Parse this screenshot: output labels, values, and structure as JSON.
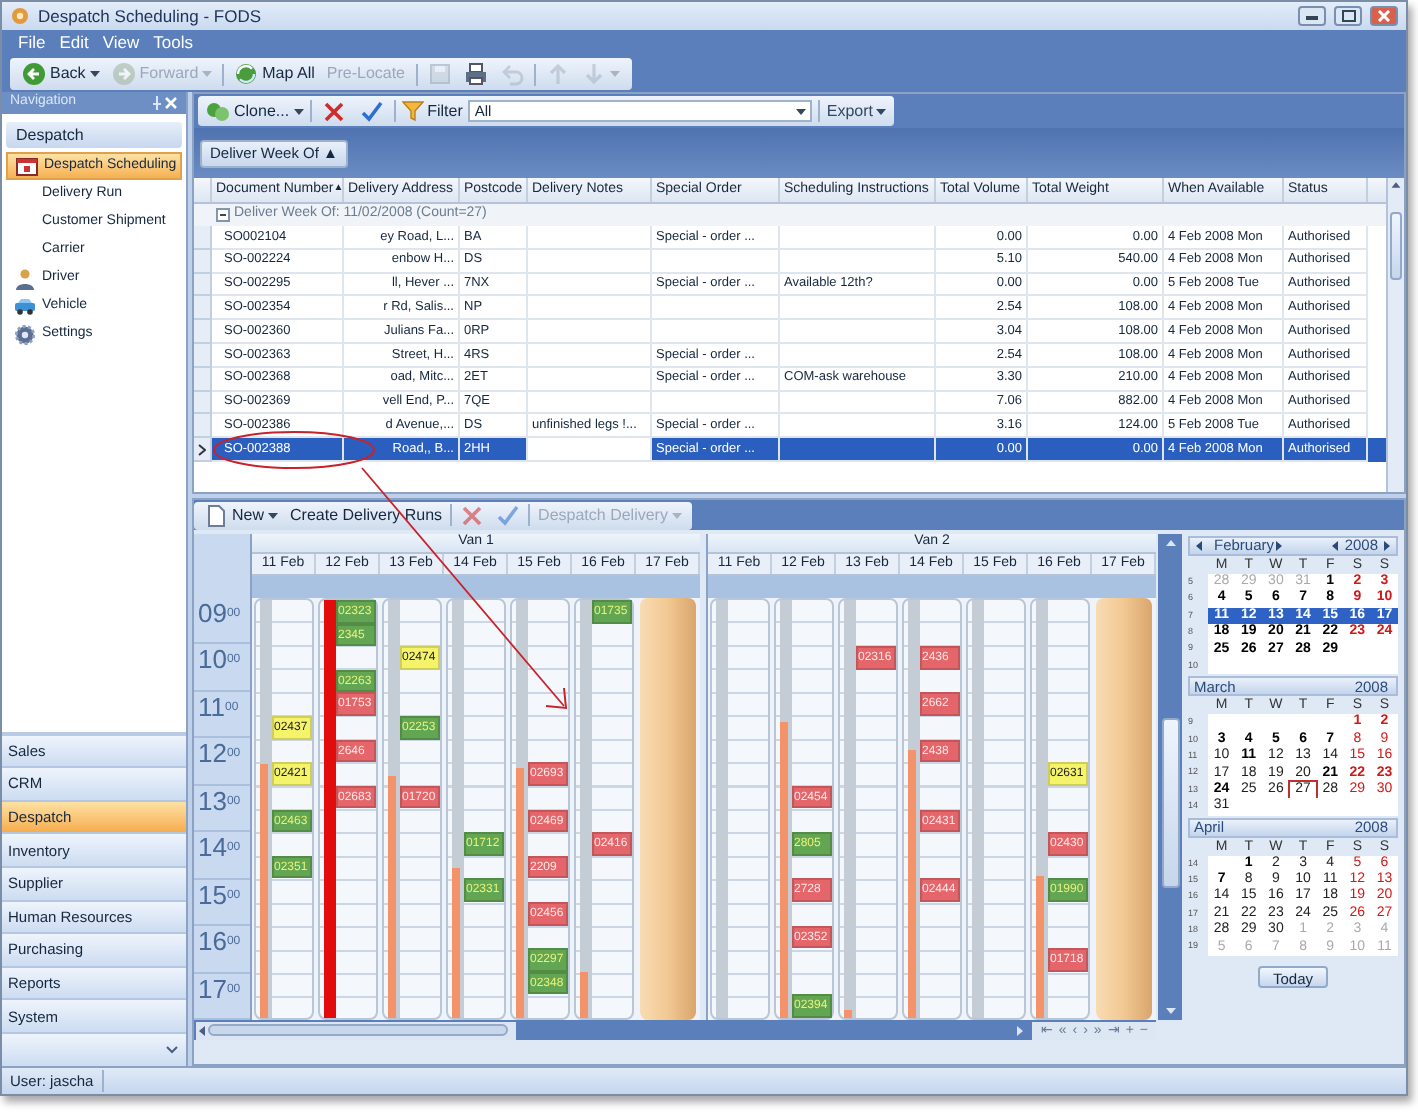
{
  "window": {
    "title": "Despatch Scheduling - FODS"
  },
  "menu": [
    "File",
    "Edit",
    "View",
    "Tools"
  ],
  "toolbar": [
    {
      "kind": "back",
      "label": "Back",
      "disabled": false,
      "dropdown": true
    },
    {
      "kind": "forward",
      "label": "Forward",
      "disabled": true,
      "dropdown": true
    },
    {
      "kind": "map",
      "label": "Map All",
      "disabled": false
    },
    {
      "kind": "text",
      "label": "Pre-Locate",
      "disabled": true
    },
    {
      "kind": "save",
      "disabled": true
    },
    {
      "kind": "print",
      "disabled": false
    },
    {
      "kind": "undo",
      "disabled": true
    },
    {
      "kind": "up",
      "disabled": true
    },
    {
      "kind": "down",
      "disabled": true,
      "dropdown": true
    }
  ],
  "navigation": {
    "title": "Navigation",
    "section": "Despatch",
    "items": [
      {
        "label": "Despatch Scheduling",
        "kind": "calendar",
        "selected": true
      },
      {
        "label": "Delivery Run",
        "kind": "plain",
        "selected": false
      },
      {
        "label": "Customer Shipment",
        "kind": "plain",
        "selected": false
      },
      {
        "label": "Carrier",
        "kind": "plain",
        "selected": false
      },
      {
        "label": "Driver",
        "kind": "person",
        "selected": false
      },
      {
        "label": "Vehicle",
        "kind": "vehicle",
        "selected": false
      },
      {
        "label": "Settings",
        "kind": "gear",
        "selected": false
      }
    ],
    "modules": [
      {
        "label": "Sales",
        "selected": false
      },
      {
        "label": "CRM",
        "selected": false
      },
      {
        "label": "Despatch",
        "selected": true
      },
      {
        "label": "Inventory",
        "selected": false
      },
      {
        "label": "Supplier",
        "selected": false
      },
      {
        "label": "Human Resources",
        "selected": false
      },
      {
        "label": "Purchasing",
        "selected": false
      },
      {
        "label": "Reports",
        "selected": false
      },
      {
        "label": "System",
        "selected": false
      }
    ]
  },
  "grid_toolbar": {
    "clone": "Clone...",
    "filter_label": "Filter",
    "filter_value": "All",
    "export": "Export"
  },
  "group_panel": {
    "button": "Deliver Week Of ▲"
  },
  "table": {
    "columns": [
      {
        "label": "Document Number",
        "sort": "▲"
      },
      {
        "label": "Delivery Address"
      },
      {
        "label": "Postcode"
      },
      {
        "label": "Delivery Notes"
      },
      {
        "label": "Special Order"
      },
      {
        "label": "Scheduling Instructions"
      },
      {
        "label": "Total Volume"
      },
      {
        "label": "Total Weight"
      },
      {
        "label": "When Available"
      },
      {
        "label": "Status"
      }
    ],
    "group_row": {
      "label": "Deliver Week Of: 11/02/2008 (Count=27)",
      "expanded": true
    },
    "rows": [
      {
        "selected": false,
        "cells": [
          "SO002104",
          "ey Road, L...",
          "BA",
          "",
          "Special - order ...",
          "",
          "0.00",
          "0.00",
          "4 Feb 2008 Mon",
          "Authorised"
        ]
      },
      {
        "selected": false,
        "cells": [
          "SO-002224",
          "enbow H...",
          "DS",
          "",
          "",
          "",
          "5.10",
          "540.00",
          "4 Feb 2008 Mon",
          "Authorised"
        ]
      },
      {
        "selected": false,
        "cells": [
          "SO-002295",
          "ll, Hever ...",
          "7NX",
          "",
          "Special - order ...",
          "Available 12th?",
          "0.00",
          "0.00",
          "5 Feb 2008 Tue",
          "Authorised"
        ]
      },
      {
        "selected": false,
        "cells": [
          "SO-002354",
          "r Rd, Salis...",
          "NP",
          "",
          "",
          "",
          "2.54",
          "108.00",
          "4 Feb 2008 Mon",
          "Authorised"
        ]
      },
      {
        "selected": false,
        "cells": [
          "SO-002360",
          "Julians Fa...",
          "0RP",
          "",
          "",
          "",
          "3.04",
          "108.00",
          "4 Feb 2008 Mon",
          "Authorised"
        ]
      },
      {
        "selected": false,
        "cells": [
          "SO-002363",
          "Street, H...",
          "4RS",
          "",
          "Special - order ...",
          "",
          "2.54",
          "108.00",
          "4 Feb 2008 Mon",
          "Authorised"
        ]
      },
      {
        "selected": false,
        "cells": [
          "SO-002368",
          "oad, Mitc...",
          "2ET",
          "",
          "Special - order ...",
          "COM-ask warehouse",
          "3.30",
          "210.00",
          "4 Feb 2008 Mon",
          "Authorised"
        ]
      },
      {
        "selected": false,
        "cells": [
          "SO-002369",
          "vell End, P...",
          "7QE",
          "",
          "",
          "",
          "7.06",
          "882.00",
          "4 Feb 2008 Mon",
          "Authorised"
        ]
      },
      {
        "selected": false,
        "cells": [
          "SO-002386",
          "d Avenue,...",
          "DS",
          "unfinished legs !...",
          "Special - order ...",
          "",
          "3.16",
          "124.00",
          "5 Feb 2008 Tue",
          "Authorised"
        ]
      },
      {
        "selected": true,
        "cells": [
          "SO-002388",
          "Road,, B...",
          "2HH",
          "",
          "Special - order ...",
          "",
          "0.00",
          "0.00",
          "4 Feb 2008 Mon",
          "Authorised"
        ]
      }
    ]
  },
  "scheduler": {
    "toolbar": [
      {
        "kind": "new",
        "label": "New",
        "disabled": false,
        "dropdown": true
      },
      {
        "kind": "text",
        "label": "Create Delivery Runs",
        "disabled": false
      },
      {
        "kind": "delete",
        "disabled": true
      },
      {
        "kind": "approve",
        "disabled": true
      },
      {
        "kind": "text",
        "label": "Despatch Delivery",
        "disabled": true,
        "dropdown": true
      }
    ],
    "times": [
      "09$^{00}$",
      "10$^{00}$",
      "11$^{00}$",
      "12$^{00}$",
      "13$^{00}$",
      "14$^{00}$",
      "15$^{00}$",
      "16$^{00}$",
      "17$^{00}$"
    ],
    "vans": [
      {
        "name": "Van 1",
        "days": [
          {
            "date": "11 Feb",
            "closed": false,
            "level": 0.61,
            "slots": [
              {
                "kind": "free"
              },
              {
                "kind": "free"
              },
              {
                "kind": "free"
              },
              {
                "kind": "free"
              },
              {
                "kind": "free"
              },
              {
                "kind": "booking",
                "ref": "02437",
                "color": "#f5f36a"
              },
              {
                "kind": "free"
              },
              {
                "kind": "booking",
                "ref": "02421",
                "color": "#f5f36a"
              },
              {
                "kind": "free"
              },
              {
                "kind": "booking",
                "ref": "02463",
                "color": "#62a552"
              },
              {
                "kind": "free"
              },
              {
                "kind": "booking",
                "ref": "02351",
                "color": "#62a552"
              }
            ]
          },
          {
            "date": "12 Feb",
            "closed": false,
            "level": 1,
            "slots": [
              {
                "kind": "booking",
                "ref": "02323",
                "color": "#62a552"
              },
              {
                "kind": "booking",
                "ref": "2345",
                "color": "#62a552"
              },
              {
                "kind": "free"
              },
              {
                "kind": "booking",
                "ref": "02263",
                "color": "#62a552"
              },
              {
                "kind": "booking",
                "ref": "01753",
                "color": "#e5666a"
              },
              {
                "kind": "free"
              },
              {
                "kind": "booking",
                "ref": "2646",
                "color": "#e5666a"
              },
              {
                "kind": "free"
              },
              {
                "kind": "booking",
                "ref": "02683",
                "color": "#e5666a"
              }
            ]
          },
          {
            "date": "13 Feb",
            "closed": false,
            "level": 0.58,
            "slots": [
              {
                "kind": "free"
              },
              {
                "kind": "free"
              },
              {
                "kind": "booking",
                "ref": "02474",
                "color": "#f5f36a"
              },
              {
                "kind": "free"
              },
              {
                "kind": "free"
              },
              {
                "kind": "booking",
                "ref": "02253",
                "color": "#62a552"
              },
              {
                "kind": "free"
              },
              {
                "kind": "free"
              },
              {
                "kind": "booking",
                "ref": "01720",
                "color": "#e5666a"
              }
            ]
          },
          {
            "date": "14 Feb",
            "closed": false,
            "level": 0.36,
            "slots": [
              {
                "kind": "free"
              },
              {
                "kind": "free"
              },
              {
                "kind": "free"
              },
              {
                "kind": "free"
              },
              {
                "kind": "free"
              },
              {
                "kind": "free"
              },
              {
                "kind": "free"
              },
              {
                "kind": "free"
              },
              {
                "kind": "free"
              },
              {
                "kind": "free"
              },
              {
                "kind": "booking",
                "ref": "01712",
                "color": "#62a552"
              },
              {
                "kind": "free"
              },
              {
                "kind": "booking",
                "ref": "02331",
                "color": "#62a552"
              }
            ]
          },
          {
            "date": "15 Feb",
            "closed": false,
            "level": 0.6,
            "slots": [
              {
                "kind": "free"
              },
              {
                "kind": "free"
              },
              {
                "kind": "free"
              },
              {
                "kind": "free"
              },
              {
                "kind": "free"
              },
              {
                "kind": "free"
              },
              {
                "kind": "free"
              },
              {
                "kind": "booking",
                "ref": "02693",
                "color": "#e5666a"
              },
              {
                "kind": "free"
              },
              {
                "kind": "booking",
                "ref": "02469",
                "color": "#e5666a"
              },
              {
                "kind": "free"
              },
              {
                "kind": "booking",
                "ref": "2209",
                "color": "#e5666a"
              },
              {
                "kind": "free"
              },
              {
                "kind": "booking",
                "ref": "02456",
                "color": "#e5666a"
              },
              {
                "kind": "free"
              },
              {
                "kind": "booking",
                "ref": "02297",
                "color": "#62a552"
              },
              {
                "kind": "booking",
                "ref": "02348",
                "color": "#62a552"
              }
            ]
          },
          {
            "date": "16 Feb",
            "closed": false,
            "level": 0.11,
            "slots": [
              {
                "kind": "booking",
                "ref": "01735",
                "color": "#62a552"
              },
              {
                "kind": "free"
              },
              {
                "kind": "free"
              },
              {
                "kind": "free"
              },
              {
                "kind": "free"
              },
              {
                "kind": "free"
              },
              {
                "kind": "free"
              },
              {
                "kind": "free"
              },
              {
                "kind": "free"
              },
              {
                "kind": "free"
              },
              {
                "kind": "booking",
                "ref": "02416",
                "color": "#e5666a"
              }
            ]
          },
          {
            "date": "17 Feb",
            "closed": true
          }
        ]
      },
      {
        "name": "Van 2",
        "days": [
          {
            "date": "11 Feb",
            "closed": false
          },
          {
            "date": "12 Feb",
            "closed": false,
            "level": 0.71,
            "slots": [
              {
                "kind": "free"
              },
              {
                "kind": "free"
              },
              {
                "kind": "free"
              },
              {
                "kind": "free"
              },
              {
                "kind": "free"
              },
              {
                "kind": "free"
              },
              {
                "kind": "free"
              },
              {
                "kind": "free"
              },
              {
                "kind": "booking",
                "ref": "02454",
                "color": "#e5666a"
              },
              {
                "kind": "free"
              },
              {
                "kind": "booking",
                "ref": "2805",
                "color": "#62a552"
              },
              {
                "kind": "free"
              },
              {
                "kind": "booking",
                "ref": "2728",
                "color": "#e5666a"
              },
              {
                "kind": "free"
              },
              {
                "kind": "booking",
                "ref": "02352",
                "color": "#e5666a"
              },
              {
                "kind": "free"
              },
              {
                "kind": "free"
              },
              {
                "kind": "booking",
                "ref": "02394",
                "color": "#62a552"
              }
            ]
          },
          {
            "date": "13 Feb",
            "closed": false,
            "level": 0.02,
            "slots": [
              {
                "kind": "free"
              },
              {
                "kind": "free"
              },
              {
                "kind": "booking",
                "ref": "02316",
                "color": "#e5666a"
              }
            ]
          },
          {
            "date": "14 Feb",
            "closed": false,
            "level": 0.64,
            "slots": [
              {
                "kind": "free"
              },
              {
                "kind": "free"
              },
              {
                "kind": "booking",
                "ref": "2436",
                "color": "#e5666a"
              },
              {
                "kind": "free"
              },
              {
                "kind": "booking",
                "ref": "2662",
                "color": "#e5666a"
              },
              {
                "kind": "free"
              },
              {
                "kind": "booking",
                "ref": "2438",
                "color": "#e5666a"
              },
              {
                "kind": "free"
              },
              {
                "kind": "free"
              },
              {
                "kind": "booking",
                "ref": "02431",
                "color": "#e5666a"
              },
              {
                "kind": "free"
              },
              {
                "kind": "free"
              },
              {
                "kind": "booking",
                "ref": "02444",
                "color": "#e5666a"
              }
            ]
          },
          {
            "date": "15 Feb",
            "closed": false
          },
          {
            "date": "16 Feb",
            "closed": false,
            "level": 0.34,
            "slots": [
              {
                "kind": "free"
              },
              {
                "kind": "free"
              },
              {
                "kind": "free"
              },
              {
                "kind": "free"
              },
              {
                "kind": "free"
              },
              {
                "kind": "free"
              },
              {
                "kind": "free"
              },
              {
                "kind": "booking",
                "ref": "02631",
                "color": "#f5f36a"
              },
              {
                "kind": "free"
              },
              {
                "kind": "free"
              },
              {
                "kind": "booking",
                "ref": "02430",
                "color": "#e5666a"
              },
              {
                "kind": "free"
              },
              {
                "kind": "booking",
                "ref": "01990",
                "color": "#62a552"
              },
              {
                "kind": "free"
              },
              {
                "kind": "free"
              },
              {
                "kind": "booking",
                "ref": "01718",
                "color": "#e5666a"
              }
            ]
          },
          {
            "date": "17 Feb",
            "closed": true
          }
        ]
      }
    ],
    "nav_buttons": [
      "⇤",
      "«",
      "‹",
      "›",
      "»",
      "⇥",
      "+",
      "−"
    ]
  },
  "calendar": {
    "today_button": "Today",
    "months": [
      {
        "month": "February",
        "year": "2008",
        "nav": true,
        "weekdays": [
          "M",
          "T",
          "W",
          "T",
          "F",
          "S",
          "S"
        ],
        "weeks": [
          {
            "num": "5",
            "selected": false,
            "days": [
              {
                "d": "28",
                "kind": "o"
              },
              {
                "d": "29",
                "kind": "o"
              },
              {
                "d": "30",
                "kind": "o"
              },
              {
                "d": "31",
                "kind": "o"
              },
              {
                "d": "1",
                "kind": "b"
              },
              {
                "d": "2",
                "kind": "bw"
              },
              {
                "d": "3",
                "kind": "bw"
              }
            ]
          },
          {
            "num": "6",
            "selected": false,
            "days": [
              {
                "d": "4",
                "kind": "b"
              },
              {
                "d": "5",
                "kind": "b"
              },
              {
                "d": "6",
                "kind": "b"
              },
              {
                "d": "7",
                "kind": "b"
              },
              {
                "d": "8",
                "kind": "b"
              },
              {
                "d": "9",
                "kind": "bw"
              },
              {
                "d": "10",
                "kind": "bw"
              }
            ]
          },
          {
            "num": "7",
            "selected": true,
            "days": [
              {
                "d": "11",
                "kind": "b"
              },
              {
                "d": "12",
                "kind": "b"
              },
              {
                "d": "13",
                "kind": "b"
              },
              {
                "d": "14",
                "kind": "b"
              },
              {
                "d": "15",
                "kind": "b"
              },
              {
                "d": "16",
                "kind": "b"
              },
              {
                "d": "17",
                "kind": "b"
              }
            ]
          },
          {
            "num": "8",
            "selected": false,
            "days": [
              {
                "d": "18",
                "kind": "b"
              },
              {
                "d": "19",
                "kind": "b"
              },
              {
                "d": "20",
                "kind": "b"
              },
              {
                "d": "21",
                "kind": "b"
              },
              {
                "d": "22",
                "kind": "b"
              },
              {
                "d": "23",
                "kind": "bw"
              },
              {
                "d": "24",
                "kind": "bw"
              }
            ]
          },
          {
            "num": "9",
            "selected": false,
            "days": [
              {
                "d": "25",
                "kind": "b"
              },
              {
                "d": "26",
                "kind": "b"
              },
              {
                "d": "27",
                "kind": "b"
              },
              {
                "d": "28",
                "kind": "b"
              },
              {
                "d": "29",
                "kind": "b"
              }
            ]
          },
          {
            "num": "10",
            "selected": false
          }
        ]
      },
      {
        "month": "March",
        "year": "2008",
        "nav": false,
        "weekdays": [
          "M",
          "T",
          "W",
          "T",
          "F",
          "S",
          "S"
        ],
        "weeks": [
          {
            "num": "9",
            "selected": false,
            "days": [
              {
                "kind": "blank"
              },
              {
                "kind": "blank"
              },
              {
                "kind": "blank"
              },
              {
                "kind": "blank"
              },
              {
                "kind": "blank"
              },
              {
                "d": "1",
                "kind": "bw"
              },
              {
                "d": "2",
                "kind": "bw"
              }
            ]
          },
          {
            "num": "10",
            "selected": false,
            "days": [
              {
                "d": "3",
                "kind": "b"
              },
              {
                "d": "4",
                "kind": "b"
              },
              {
                "d": "5",
                "kind": "b"
              },
              {
                "d": "6",
                "kind": "b"
              },
              {
                "d": "7",
                "kind": "b"
              },
              {
                "d": "8",
                "kind": "w"
              },
              {
                "d": "9",
                "kind": "w"
              }
            ]
          },
          {
            "num": "11",
            "selected": false,
            "days": [
              {
                "d": "10",
                "kind": "p"
              },
              {
                "d": "11",
                "kind": "b"
              },
              {
                "d": "12",
                "kind": "p"
              },
              {
                "d": "13",
                "kind": "p"
              },
              {
                "d": "14",
                "kind": "p"
              },
              {
                "d": "15",
                "kind": "w"
              },
              {
                "d": "16",
                "kind": "w"
              }
            ]
          },
          {
            "num": "12",
            "selected": false,
            "days": [
              {
                "d": "17",
                "kind": "p"
              },
              {
                "d": "18",
                "kind": "p"
              },
              {
                "d": "19",
                "kind": "p"
              },
              {
                "d": "20",
                "kind": "p"
              },
              {
                "d": "21",
                "kind": "b"
              },
              {
                "d": "22",
                "kind": "bw"
              },
              {
                "d": "23",
                "kind": "bw"
              }
            ]
          },
          {
            "num": "13",
            "selected": false,
            "days": [
              {
                "d": "24",
                "kind": "b"
              },
              {
                "d": "25",
                "kind": "p"
              },
              {
                "d": "26",
                "kind": "p"
              },
              {
                "d": "27",
                "kind": "today"
              },
              {
                "d": "28",
                "kind": "p"
              },
              {
                "d": "29",
                "kind": "w"
              },
              {
                "d": "30",
                "kind": "w"
              }
            ]
          },
          {
            "num": "14",
            "selected": false,
            "days": [
              {
                "d": "31",
                "kind": "p"
              }
            ]
          }
        ]
      },
      {
        "month": "April",
        "year": "2008",
        "nav": false,
        "weekdays": [
          "M",
          "T",
          "W",
          "T",
          "F",
          "S",
          "S"
        ],
        "weeks": [
          {
            "num": "14",
            "selected": false,
            "days": [
              {
                "kind": "blank"
              },
              {
                "d": "1",
                "kind": "b"
              },
              {
                "d": "2",
                "kind": "p"
              },
              {
                "d": "3",
                "kind": "p"
              },
              {
                "d": "4",
                "kind": "p"
              },
              {
                "d": "5",
                "kind": "w"
              },
              {
                "d": "6",
                "kind": "w"
              }
            ]
          },
          {
            "num": "15",
            "selected": false,
            "days": [
              {
                "d": "7",
                "kind": "b"
              },
              {
                "d": "8",
                "kind": "p"
              },
              {
                "d": "9",
                "kind": "p"
              },
              {
                "d": "10",
                "kind": "p"
              },
              {
                "d": "11",
                "kind": "p"
              },
              {
                "d": "12",
                "kind": "w"
              },
              {
                "d": "13",
                "kind": "w"
              }
            ]
          },
          {
            "num": "16",
            "selected": false,
            "days": [
              {
                "d": "14",
                "kind": "p"
              },
              {
                "d": "15",
                "kind": "p"
              },
              {
                "d": "16",
                "kind": "p"
              },
              {
                "d": "17",
                "kind": "p"
              },
              {
                "d": "18",
                "kind": "p"
              },
              {
                "d": "19",
                "kind": "w"
              },
              {
                "d": "20",
                "kind": "w"
              }
            ]
          },
          {
            "num": "17",
            "selected": false,
            "days": [
              {
                "d": "21",
                "kind": "p"
              },
              {
                "d": "22",
                "kind": "p"
              },
              {
                "d": "23",
                "kind": "p"
              },
              {
                "d": "24",
                "kind": "p"
              },
              {
                "d": "25",
                "kind": "p"
              },
              {
                "d": "26",
                "kind": "w"
              },
              {
                "d": "27",
                "kind": "w"
              }
            ]
          },
          {
            "num": "18",
            "selected": false,
            "days": [
              {
                "d": "28",
                "kind": "p"
              },
              {
                "d": "29",
                "kind": "p"
              },
              {
                "d": "30",
                "kind": "p"
              },
              {
                "d": "1",
                "kind": "o"
              },
              {
                "d": "2",
                "kind": "o"
              },
              {
                "d": "3",
                "kind": "o"
              },
              {
                "d": "4",
                "kind": "o"
              }
            ]
          },
          {
            "num": "19",
            "selected": false,
            "days": [
              {
                "d": "5",
                "kind": "o"
              },
              {
                "d": "6",
                "kind": "o"
              },
              {
                "d": "7",
                "kind": "o"
              },
              {
                "d": "8",
                "kind": "o"
              },
              {
                "d": "9",
                "kind": "o"
              },
              {
                "d": "10",
                "kind": "o"
              },
              {
                "d": "11",
                "kind": "o"
              }
            ]
          }
        ]
      }
    ]
  },
  "status_bar": {
    "user": "User: jascha"
  }
}
